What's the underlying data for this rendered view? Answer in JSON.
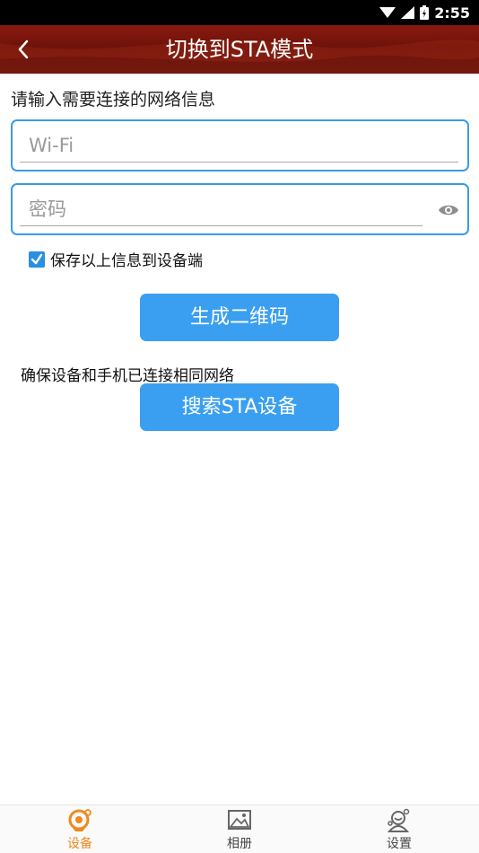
{
  "status_bar": {
    "time": "2:55"
  },
  "header": {
    "title": "切换到STA模式"
  },
  "form": {
    "section_title": "请输入需要连接的网络信息",
    "wifi_placeholder": "Wi-Fi",
    "password_placeholder": "密码",
    "remember_label": "保存以上信息到设备端",
    "remember_checked": true
  },
  "buttons": {
    "generate_qr": "生成二维码",
    "search_sta": "搜索STA设备"
  },
  "notice": "确保设备和手机已连接相同网络",
  "tabbar": {
    "items": [
      {
        "label": "设备",
        "icon": "camera-icon",
        "active": true
      },
      {
        "label": "相册",
        "icon": "gallery-icon",
        "active": false
      },
      {
        "label": "设置",
        "icon": "settings-person-icon",
        "active": false
      }
    ]
  },
  "colors": {
    "header": "#7b1b12",
    "accent": "#3a9ff0",
    "active_tab": "#f0891e"
  }
}
